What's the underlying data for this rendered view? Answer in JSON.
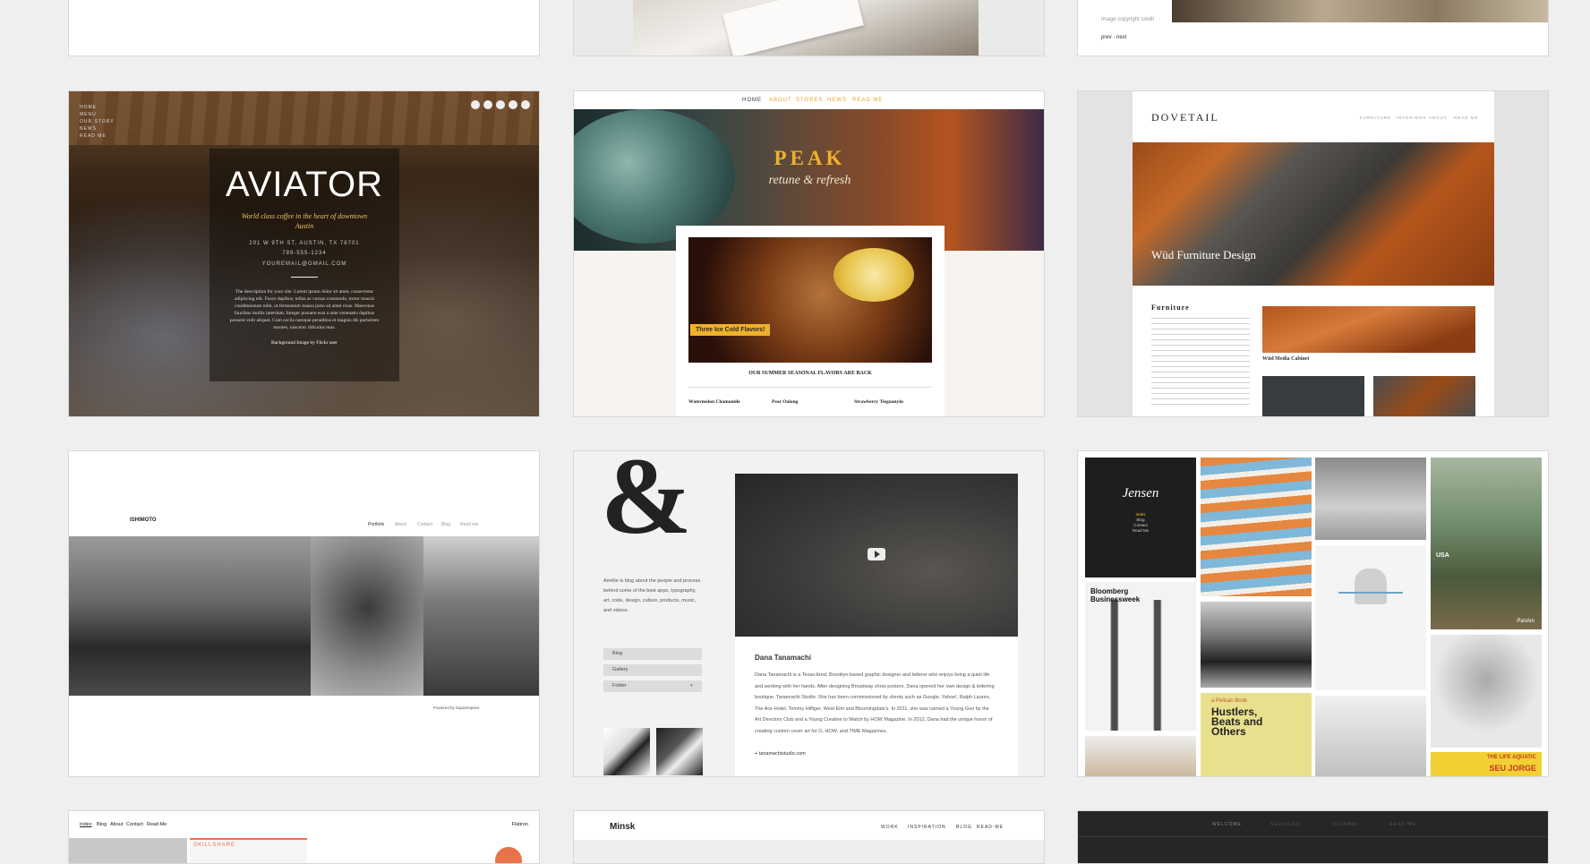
{
  "aviator": {
    "title": "AVIATOR",
    "tagline": "World class coffee in the heart of downtown Austin",
    "address": "201 W 9TH ST, AUSTIN, TX 78701",
    "phone": "789-555-1234",
    "email": "YOUREMAIL@GMAIL.COM",
    "description": "The description for your site. Lorem ipsum dolor sit amet, consectetur adipiscing elit. Fusce dapibus, tellus ac cursus commodo, tortor mauris condimentum nibh, ut fermentum massa justo sit amet risus. Maecenas faucibus mollis interdum. Integer posuere erat a ante venenatis dapibus posuere velit aliquet. Cum sociis natoque penatibus et magnis dis parturient montes, nascetur ridiculus mus.",
    "credit": "Background Image by Flickr user"
  },
  "peak": {
    "nav": [
      "HOME",
      "ABOUT",
      "STORES",
      "NEWS",
      "READ ME"
    ],
    "title": "PEAK",
    "subtitle": "retune & refresh",
    "badge": "Three Ice Cold Flavors!",
    "heading": "OUR SUMMER SEASONAL FLAVORS ARE BACK",
    "flavors": [
      "Watermelon Chamomile",
      "Pear Oolong",
      "Strawberry Tieguanyin"
    ]
  },
  "dovetail": {
    "logo": "DOVETAIL",
    "nav": [
      "FURNITURE",
      "INTERIORS",
      "ABOUT",
      "READ ME"
    ],
    "hero_title": "Wüd Furniture Design",
    "section_title": "Furniture",
    "caption": "Wüd Media Cabinet"
  },
  "ishimoto": {
    "logo": "ISHIMOTO",
    "nav": [
      "Portfolio",
      "About",
      "Contact",
      "Blog",
      "Read me"
    ],
    "footer": "Powered by Squarespace"
  },
  "amelie": {
    "glyph": "&",
    "description": "Amélie is blog about the people and process behind some of the best apps, typography, art, code, design, culture, products, music, and videos.",
    "menu": [
      "Blog",
      "Gallery",
      "Folder"
    ],
    "post_title": "Dana Tanamachi",
    "post_body": "Dana Tanamachi is a Texas-bred, Brooklyn-based graphic designer and letterer who enjoys living a quiet life and working with her hands. After designing Broadway show posters, Dana opened her own design & lettering boutique, Tanamachi Studio. She has been commissioned by clients such as Google, Yahoo!, Ralph Lauren, The Ace Hotel, Tommy Hilfiger, West Elm and Bloomingdale's. In 2011, she was named a Young Gun by the Art Directors Club and a Young Creative to Watch by HOW Magazine. In 2012, Dana had the unique honor of creating custom cover art for O, HOW, and TIME Magazines.",
    "link": "+ tanamachistudio.com"
  },
  "jensen": {
    "title": "Jensen",
    "menu": [
      "Index",
      "Blog",
      "Contact",
      "Read Me"
    ],
    "tiles": [
      "Bloomberg Businessweek",
      "USA",
      "a Pelican Book",
      "Hustlers, Beats and Others",
      "THE LIFE AQUATIC",
      "SEU JORGE",
      "PanAm"
    ]
  },
  "flatiron": {
    "nav": [
      "Index",
      "Blog",
      "About",
      "Contact",
      "Read Me"
    ],
    "brand": "Flatiron",
    "banner": "SKILLSHARE"
  },
  "minsk": {
    "logo": "Minsk",
    "nav": [
      "WORK",
      "INSPIRATION",
      "BLOG",
      "READ-ME"
    ]
  },
  "dark": {
    "nav": [
      "WELCOME",
      "SERVICES",
      "JOURNAL",
      "READ ME"
    ]
  }
}
